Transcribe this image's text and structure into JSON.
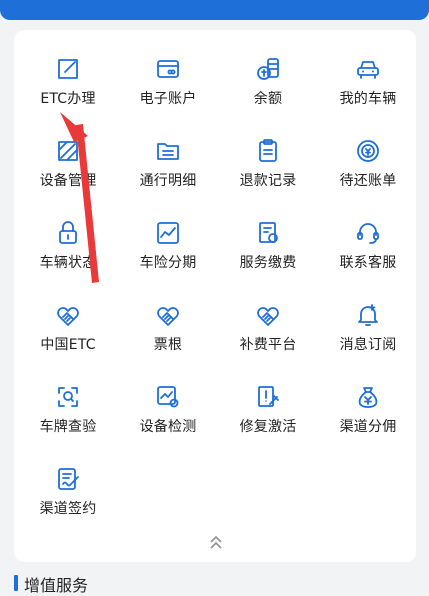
{
  "grid": {
    "items": [
      {
        "label": "ETC办理",
        "icon": "edit-square-icon"
      },
      {
        "label": "电子账户",
        "icon": "bank-card-icon"
      },
      {
        "label": "余额",
        "icon": "coin-stack-icon"
      },
      {
        "label": "我的车辆",
        "icon": "car-icon"
      },
      {
        "label": "设备管理",
        "icon": "device-tag-icon"
      },
      {
        "label": "通行明细",
        "icon": "folder-list-icon"
      },
      {
        "label": "退款记录",
        "icon": "clipboard-icon"
      },
      {
        "label": "待还账单",
        "icon": "yuan-circle-icon"
      },
      {
        "label": "车辆状态",
        "icon": "lock-icon"
      },
      {
        "label": "车险分期",
        "icon": "trend-chart-icon"
      },
      {
        "label": "服务缴费",
        "icon": "payment-doc-icon"
      },
      {
        "label": "联系客服",
        "icon": "headset-icon"
      },
      {
        "label": "中国ETC",
        "icon": "handshake-heart-icon"
      },
      {
        "label": "票根",
        "icon": "handshake-heart-icon"
      },
      {
        "label": "补费平台",
        "icon": "handshake-heart-icon"
      },
      {
        "label": "消息订阅",
        "icon": "bell-plus-icon"
      },
      {
        "label": "车牌查验",
        "icon": "scan-icon"
      },
      {
        "label": "设备检测",
        "icon": "device-check-icon"
      },
      {
        "label": "修复激活",
        "icon": "repair-icon"
      },
      {
        "label": "渠道分佣",
        "icon": "money-bag-icon"
      },
      {
        "label": "渠道签约",
        "icon": "sign-doc-icon"
      }
    ]
  },
  "collapse_icon": "double-chevron-up-icon",
  "section": {
    "title": "增值服务"
  },
  "colors": {
    "primary": "#1f6fd8",
    "annotation": "#e83a3a",
    "text": "#222222",
    "background": "#f2f3f5"
  }
}
